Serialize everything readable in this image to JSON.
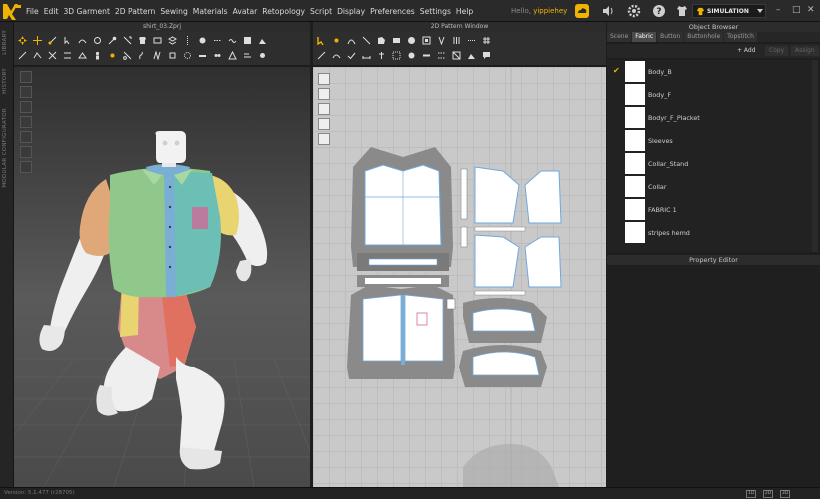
{
  "menubar": {
    "items": [
      "File",
      "Edit",
      "3D Garment",
      "2D Pattern",
      "Sewing",
      "Materials",
      "Avatar",
      "Retopology",
      "Script",
      "Display",
      "Preferences",
      "Settings",
      "Help"
    ],
    "hello_label": "Hello,",
    "username": "yippiehey",
    "mode_label": "SIMULATION"
  },
  "side_tabs": [
    "LIBRARY",
    "HISTORY",
    "MODULAR CONFIGURATOR"
  ],
  "panels": {
    "viewport3d_title": "shirt_03.Zprj",
    "viewport2d_title": "2D Pattern Window"
  },
  "object_browser": {
    "title": "Object Browser",
    "tabs": [
      "Scene",
      "Fabric",
      "Button",
      "Buttonhole",
      "Topstitch"
    ],
    "active_tab": 1,
    "add_label": "+ Add",
    "copy_label": "Copy",
    "assign_label": "Assign",
    "fabrics": [
      {
        "name": "Body_B",
        "selected": true
      },
      {
        "name": "Body_F",
        "selected": false
      },
      {
        "name": "Bodyr_F_Placket",
        "selected": false
      },
      {
        "name": "Sleeves",
        "selected": false
      },
      {
        "name": "Collar_Stand",
        "selected": false
      },
      {
        "name": "Collar",
        "selected": false
      },
      {
        "name": "FABRIC 1",
        "selected": false
      },
      {
        "name": "stripes hemd",
        "selected": false
      }
    ]
  },
  "property_editor": {
    "title": "Property Editor"
  },
  "statusbar": {
    "version": "Version: 5.1.477 (r28705)",
    "icons": [
      "1D",
      "2D",
      "3D"
    ]
  },
  "colors": {
    "accent": "#f0b400",
    "garment_green": "#8fc88a",
    "garment_teal": "#6bbfb5",
    "garment_orange": "#e0a878",
    "garment_yellow": "#e8d470",
    "garment_pink": "#d88a8a",
    "garment_red": "#e07060"
  }
}
